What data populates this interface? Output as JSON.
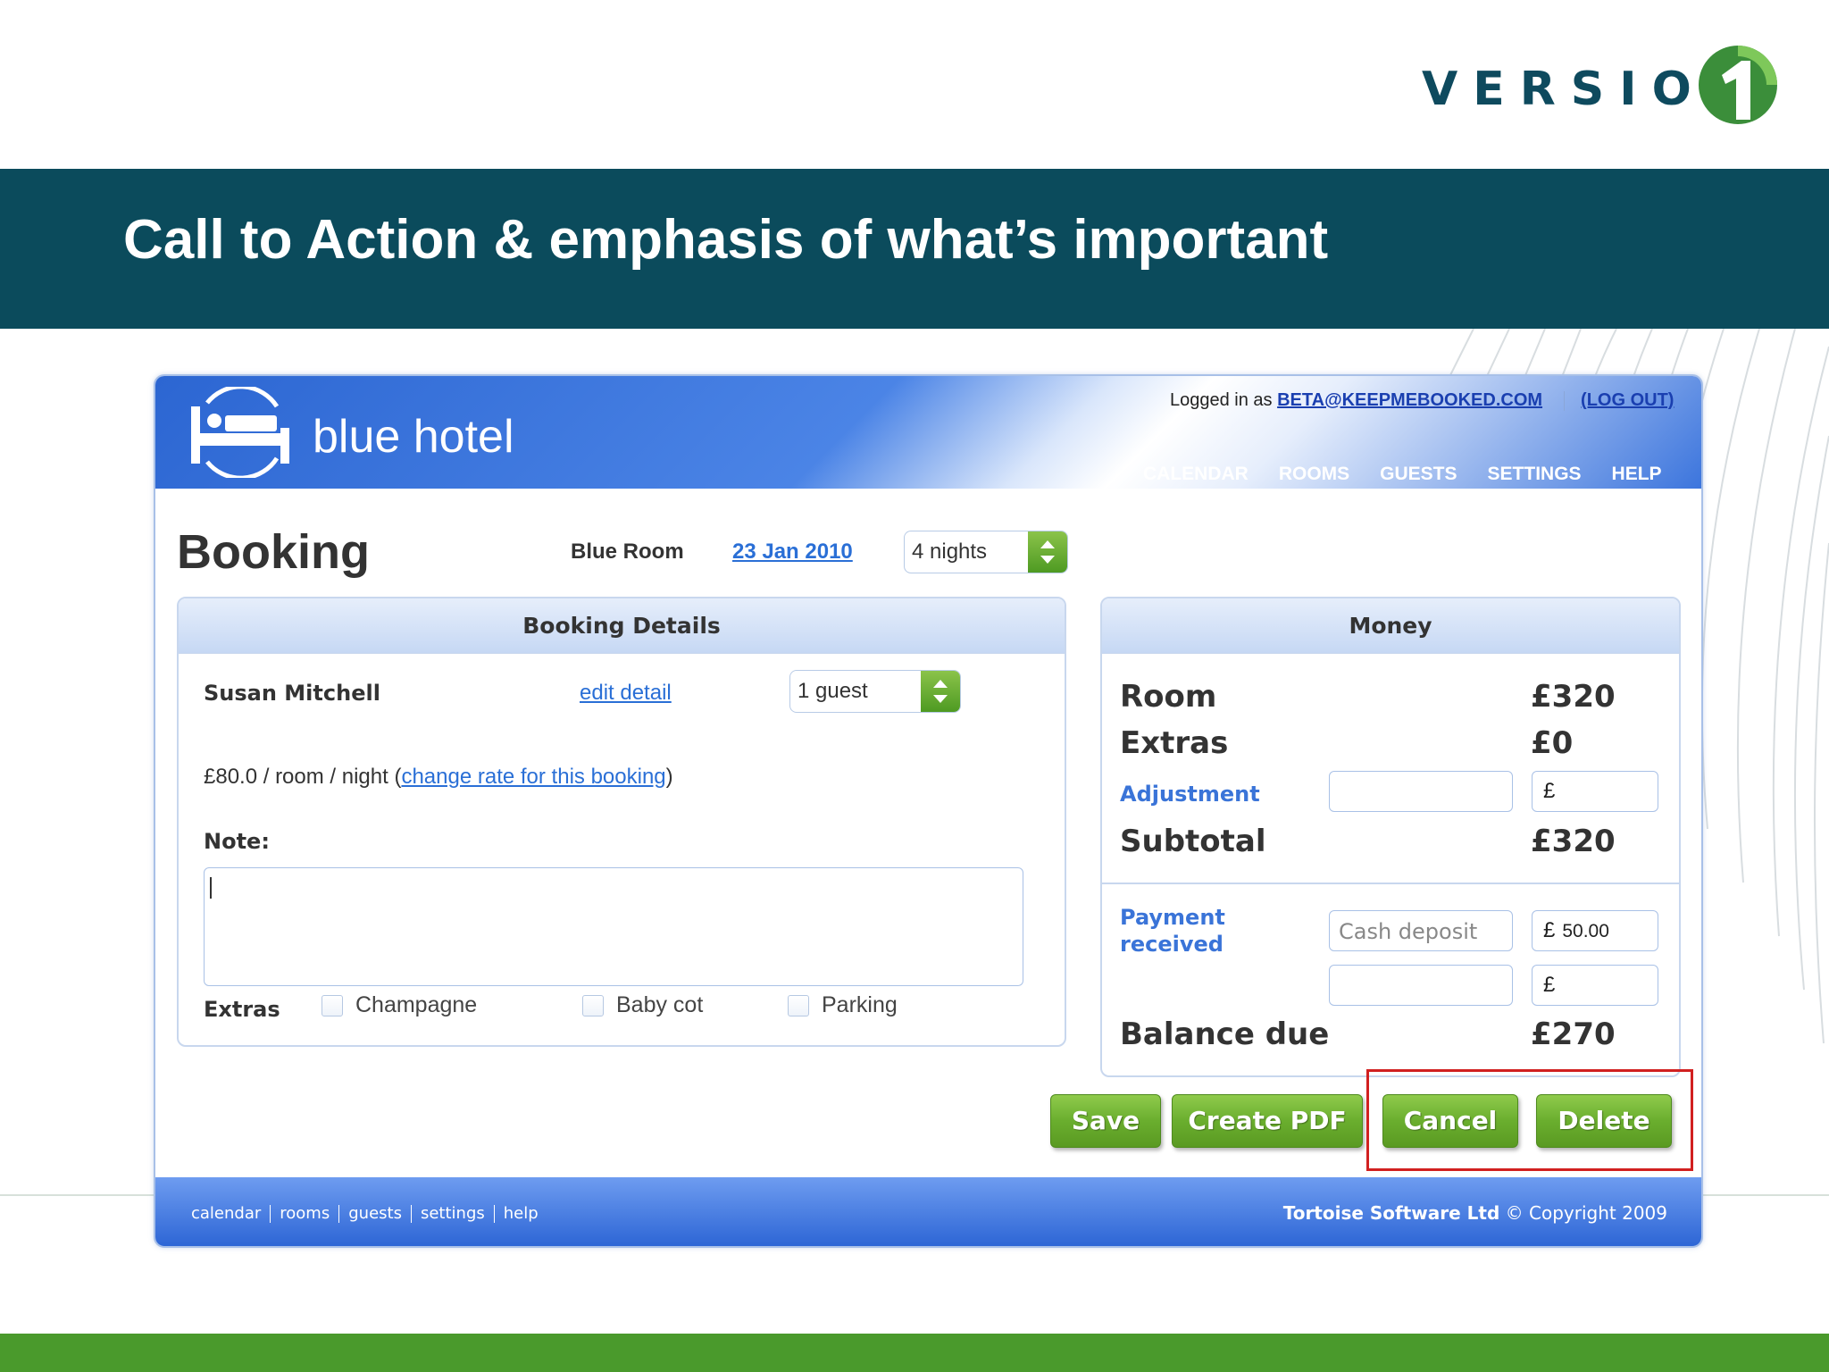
{
  "slide": {
    "logo_text": "VERSION",
    "logo_mark": "1",
    "title": "Call to Action & emphasis of what’s important",
    "colors": {
      "banner": "#0b4b5c",
      "bottom_bar": "#4a9a2c",
      "button": "#6aae2e",
      "highlight": "#d12020"
    }
  },
  "app": {
    "brand": "blue hotel",
    "brand_icon": "bed-icon",
    "login_prefix": "Logged in as ",
    "login_user": "BETA@KEEPMEBOOKED.COM",
    "logout": "(LOG OUT)",
    "nav": [
      "CALENDAR",
      "ROOMS",
      "GUESTS",
      "SETTINGS",
      "HELP"
    ],
    "page_title": "Booking",
    "room": "Blue Room",
    "date": "23 Jan 2010",
    "nights": "4 nights",
    "booking_details": {
      "title": "Booking Details",
      "guest_name": "Susan Mitchell",
      "edit_link": "edit detail",
      "guests": "1 guest",
      "rate_prefix": "£80.0 / room / night (",
      "rate_link": "change rate for this booking",
      "rate_suffix": ")",
      "note_label": "Note:",
      "note_value": "",
      "extras_label": "Extras",
      "extras": [
        {
          "label": "Champagne",
          "checked": false
        },
        {
          "label": "Baby cot",
          "checked": false
        },
        {
          "label": "Parking",
          "checked": false
        }
      ]
    },
    "money": {
      "title": "Money",
      "room_label": "Room",
      "room_value": "£320",
      "extras_label": "Extras",
      "extras_value": "£0",
      "adjustment_label": "Adjustment",
      "adjustment_currency": "£",
      "subtotal_label": "Subtotal",
      "subtotal_value": "£320",
      "payment_label_1": "Payment",
      "payment_label_2": "received",
      "payment_method_placeholder": "Cash deposit",
      "payment_currency": "£",
      "payment_amount": "50.00",
      "payment2_currency": "£",
      "balance_label": "Balance due",
      "balance_value": "£270"
    },
    "buttons": {
      "save": "Save",
      "pdf": "Create PDF",
      "cancel": "Cancel",
      "delete": "Delete"
    },
    "footer": {
      "links": [
        "calendar",
        "rooms",
        "guests",
        "settings",
        "help"
      ],
      "company": "Tortoise Software Ltd",
      "copyright": " © Copyright 2009"
    }
  }
}
